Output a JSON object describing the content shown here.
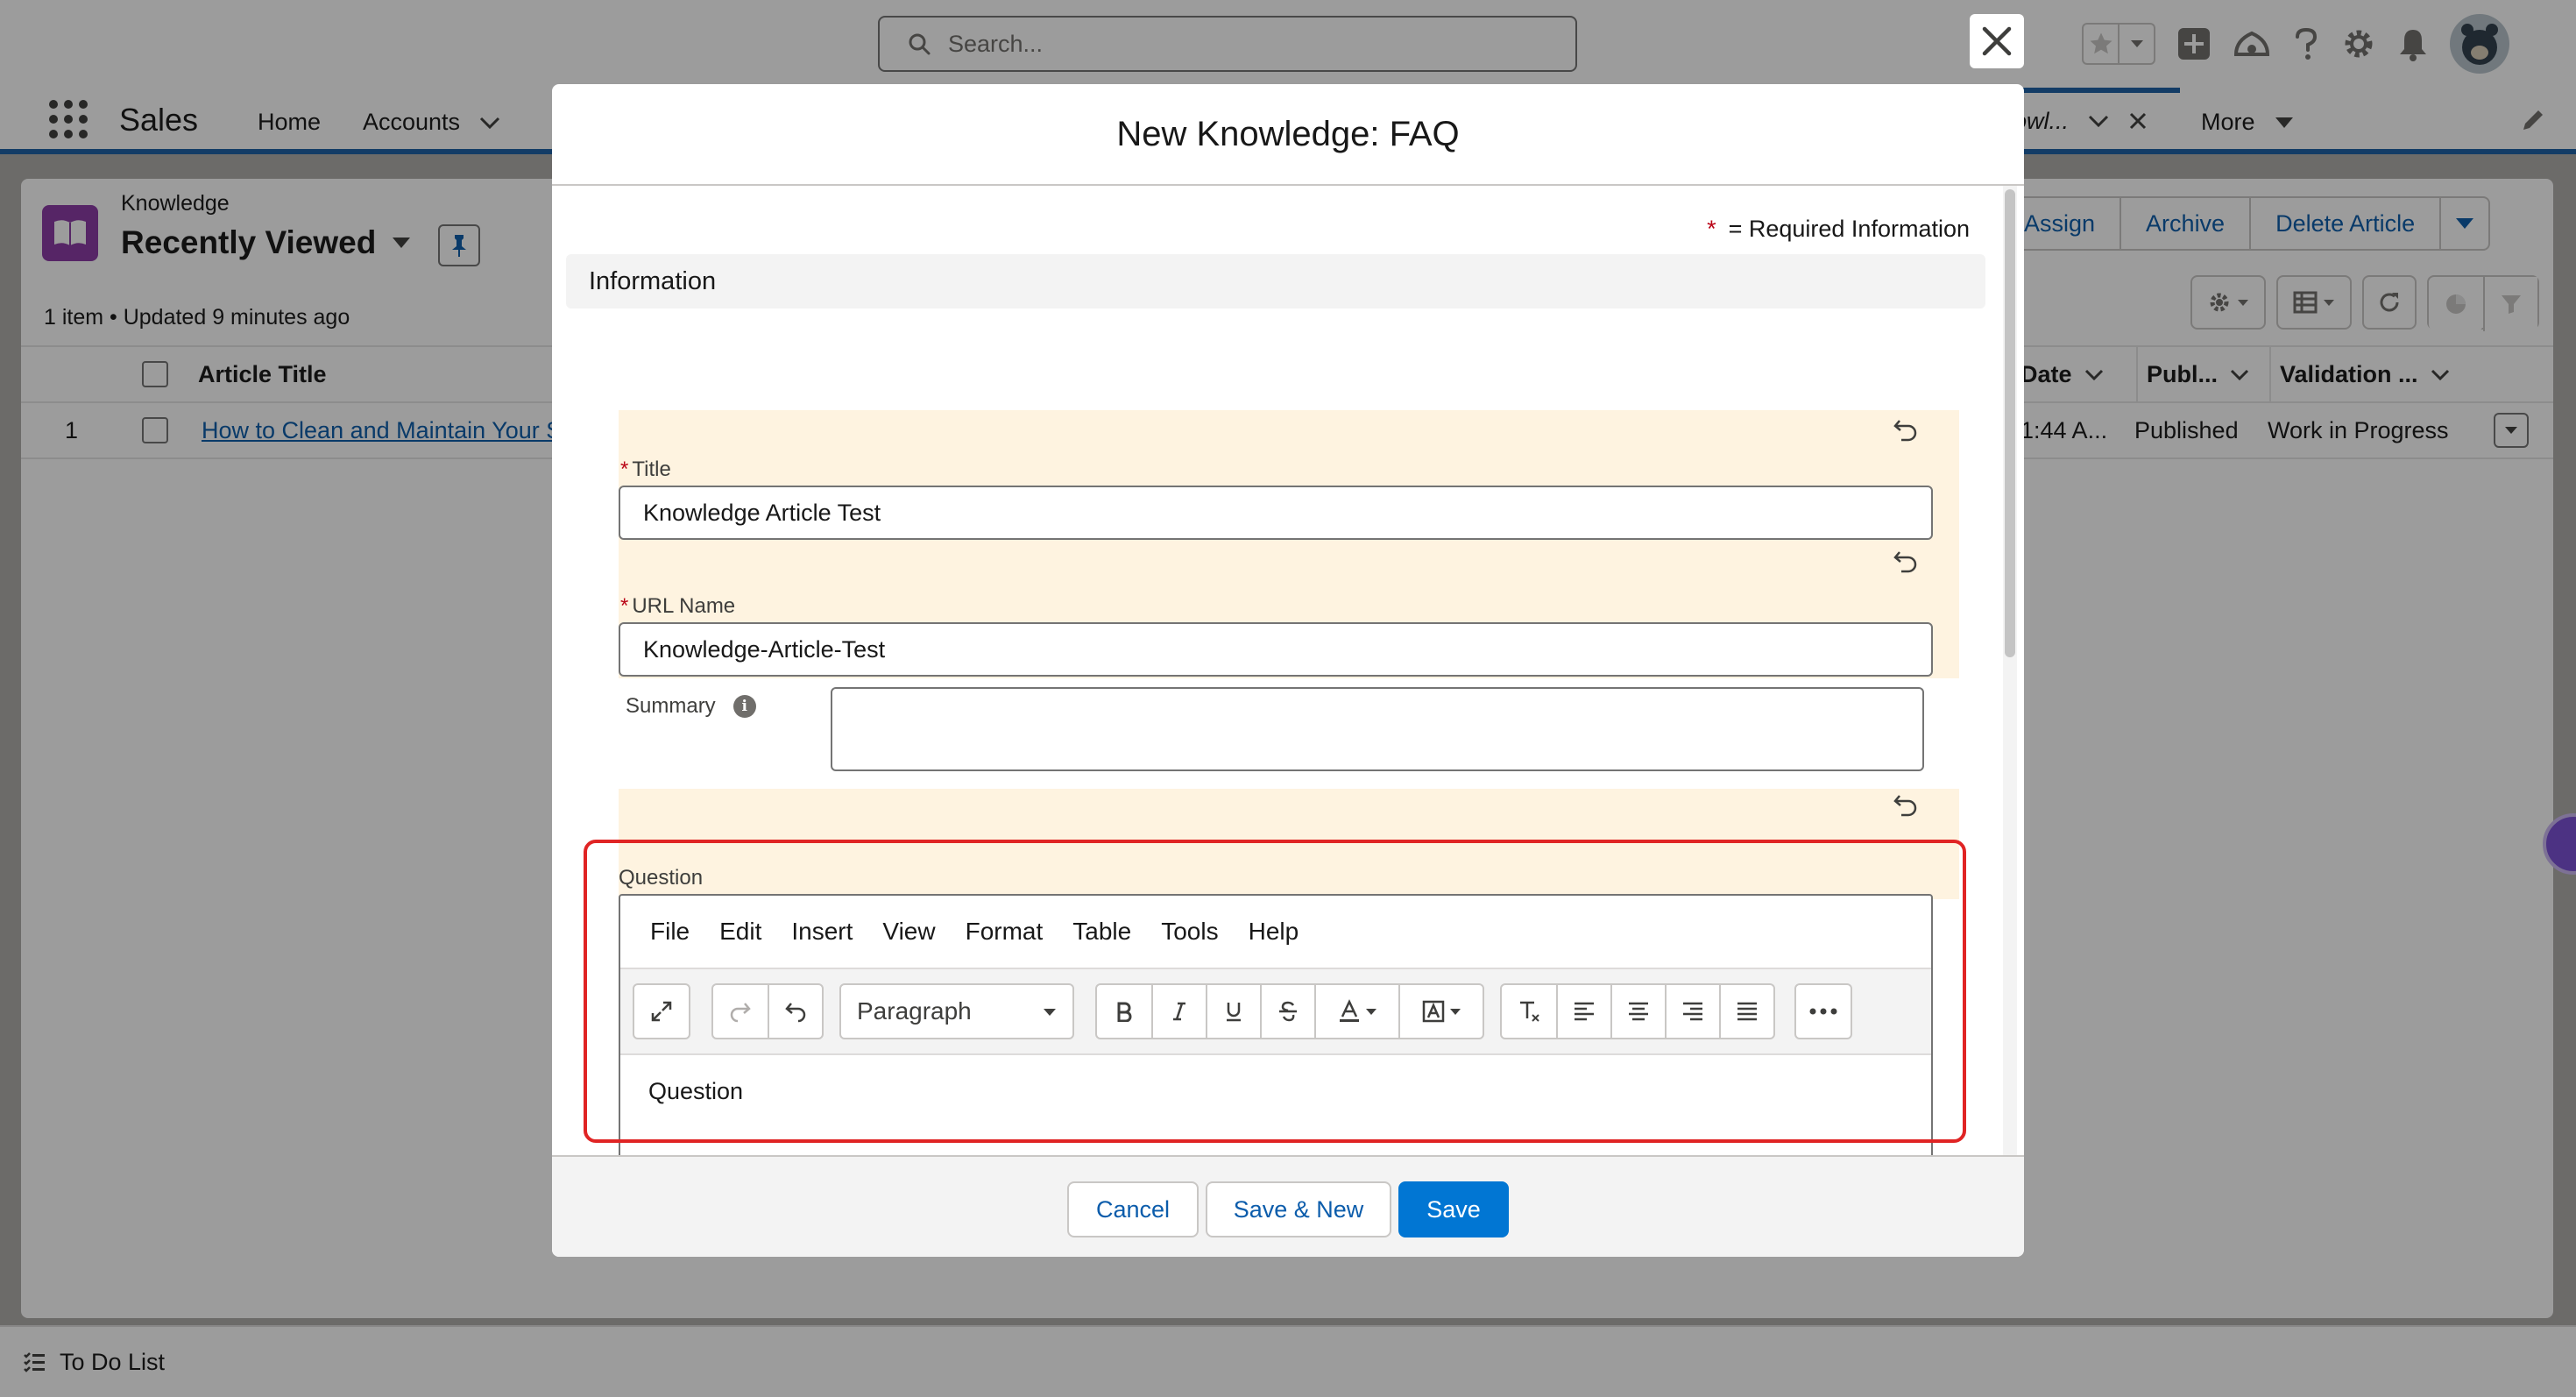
{
  "global_header": {
    "search_placeholder": "Search..."
  },
  "nav": {
    "app_name": "Sales",
    "items": [
      {
        "label": "Home"
      },
      {
        "label": "Accounts"
      }
    ],
    "open_tab_label": "owl...",
    "more_label": "More"
  },
  "list_view": {
    "object_label": "Knowledge",
    "view_name": "Recently Viewed",
    "meta": "1 item • Updated 9 minutes ago",
    "actions": [
      "Assign",
      "Archive",
      "Delete Article"
    ],
    "columns": [
      {
        "label": "Article Title"
      },
      {
        "label": "Date"
      },
      {
        "label": "Publ..."
      },
      {
        "label": "Validation ..."
      }
    ],
    "rows": [
      {
        "num": "1",
        "title": "How to Clean and Maintain Your S",
        "date": "1:44 A...",
        "status": "Published",
        "validation": "Work in Progress"
      }
    ]
  },
  "utility_bar": {
    "label": "To Do List"
  },
  "modal": {
    "title": "New Knowledge: FAQ",
    "required_info": "= Required Information",
    "section": "Information",
    "fields": {
      "title": {
        "label": "Title",
        "value": "Knowledge Article Test"
      },
      "url_name": {
        "label": "URL Name",
        "value": "Knowledge-Article-Test"
      },
      "summary": {
        "label": "Summary",
        "value": ""
      },
      "question": {
        "label": "Question"
      }
    },
    "editor": {
      "menu": [
        "File",
        "Edit",
        "Insert",
        "View",
        "Format",
        "Table",
        "Tools",
        "Help"
      ],
      "block_format": "Paragraph",
      "content": "Question"
    },
    "footer": {
      "cancel": "Cancel",
      "save_new": "Save & New",
      "save": "Save"
    }
  },
  "colors": {
    "brand_blue": "#0176d3",
    "link_blue": "#0b5cab",
    "required_red": "#ba0517",
    "highlight_box": "#e02424",
    "field_highlight": "#fef3e0",
    "knowledge_icon": "#8a3aa5"
  },
  "icons": [
    "search-icon",
    "close-icon",
    "favorites-star-icon",
    "add-icon",
    "trailhead-icon",
    "help-icon",
    "setup-gear-icon",
    "bell-icon",
    "avatar-icon",
    "app-launcher-icon",
    "pin-icon",
    "undo-icon",
    "info-icon",
    "fullscreen-icon",
    "redo-icon",
    "bold-icon",
    "italic-icon",
    "underline-icon",
    "strikethrough-icon",
    "text-color-icon",
    "highlight-color-icon",
    "clear-format-icon",
    "align-left-icon",
    "align-center-icon",
    "align-right-icon",
    "justify-icon",
    "more-icon",
    "todo-list-icon"
  ]
}
